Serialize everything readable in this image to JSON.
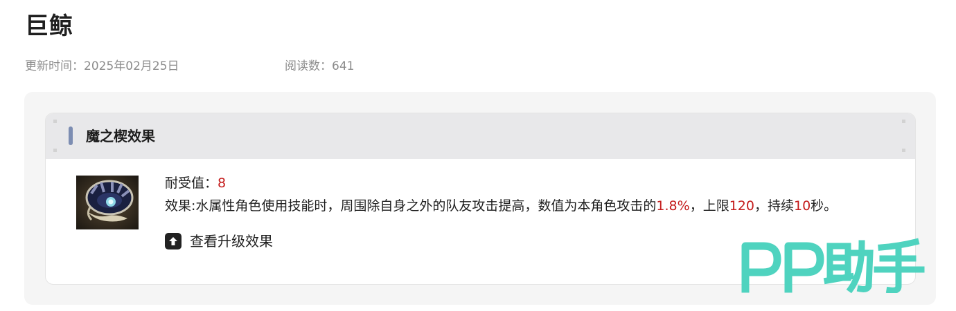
{
  "page": {
    "title": "巨鲸",
    "updated_label": "更新时间：2025年02月25日",
    "reads_label": "阅读数：641"
  },
  "card": {
    "header_title": "魔之楔效果",
    "image_icon": "whale-wedge-item-icon",
    "stat_label": "耐受值：",
    "stat_value": "8",
    "effect": {
      "prefix": "效果:水属性角色使用技能时，周围除自身之外的队友攻击提高，数值为本角色攻击的",
      "percent": "1.8%",
      "mid1": "，上限",
      "cap": "120",
      "mid2": "，持续",
      "duration": "10",
      "suffix": "秒。"
    },
    "upgrade_link": "查看升级效果",
    "upgrade_icon": "arrow-up-icon"
  },
  "watermark": {
    "text": "PP助手"
  },
  "colors": {
    "highlight": "#c41b1b",
    "watermark": "#4fd3bf",
    "header_bar": "#7c8db2"
  }
}
